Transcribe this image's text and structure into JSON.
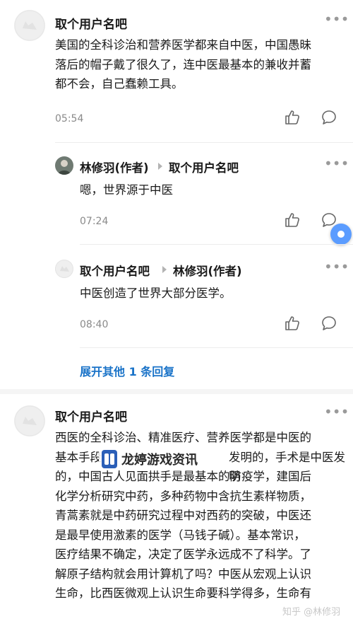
{
  "comments": [
    {
      "username": "取个用户名吧",
      "lines": [
        "美国的全科诊治和营养医学都来自中医，中国愚昧",
        "落后的帽子戴了很久了，连中医最基本的兼收并蓄",
        "都不会，自己蠢赖工具。"
      ],
      "time": "05:54",
      "replies": [
        {
          "username": "林修羽(作者)",
          "target": "取个用户名吧",
          "text": "嗯，世界源于中医",
          "time": "07:24"
        },
        {
          "username": "取个用户名吧",
          "target": "林修羽(作者)",
          "text": "中医创造了世界大部分医学。",
          "time": "08:40"
        }
      ],
      "expand_label": "展开其他 1 条回复"
    },
    {
      "username": "取个用户名吧",
      "lines": [
        "西医的全科诊治、精准医疗、营养医学都是中医的",
        "基本手段，",
        "发明的，手术是中医发明",
        "的，中国古人见面拱手是最基本的防疫学，建国后",
        "化学分析研究中药，多种药物中含抗生素样物质，",
        "青蒿素就是中药研究过程中对西药的突破，中医还",
        "是最早使用激素的医学（马钱子碱）。基本常识，",
        "医疗结果不确定，决定了医学永远成不了科学。了",
        "解原子结构就会用计算机了吗？中医从宏观上认识",
        "生命，比西医微观上认识生命要科学得多，生命有"
      ]
    }
  ],
  "watermark": {
    "label": "龙婷游戏资讯",
    "tail": "知乎 @林修羽"
  },
  "more_glyph": "•••"
}
